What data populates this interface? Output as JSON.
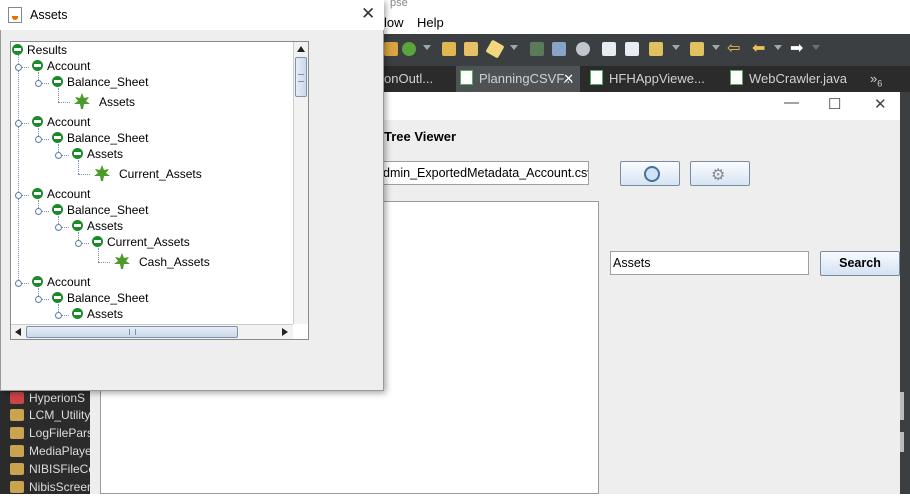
{
  "eclipse": {
    "title_fragment": "pse",
    "menu": [
      "low",
      "Help"
    ],
    "tabs": [
      "onOutl...",
      "PlanningCSVF...",
      "HFHAppViewe...",
      "WebCrawler.java",
      "»"
    ],
    "tab_overflow_count": "6",
    "projects": [
      "HyperionS",
      "LCM_Utility",
      "LogFilePars",
      "MediaPlaye",
      "NIBISFileCo",
      "NibisScreen"
    ]
  },
  "app": {
    "heading": "Tree Viewer",
    "file_value": "dmin_ExportedMetadata_Account.csv",
    "search_value": "Assets",
    "search_label": "Search"
  },
  "dialog": {
    "title": "Assets",
    "close": "✕",
    "tree": [
      {
        "label": "Results"
      },
      {
        "label": "Account"
      },
      {
        "label": "Balance_Sheet"
      },
      {
        "label": "Assets"
      },
      {
        "label": "Account"
      },
      {
        "label": "Balance_Sheet"
      },
      {
        "label": "Assets"
      },
      {
        "label": "Current_Assets"
      },
      {
        "label": "Account"
      },
      {
        "label": "Balance_Sheet"
      },
      {
        "label": "Assets"
      },
      {
        "label": "Current_Assets"
      },
      {
        "label": "Cash_Assets"
      },
      {
        "label": "Account"
      },
      {
        "label": "Balance_Sheet"
      },
      {
        "label": "Assets"
      }
    ]
  }
}
